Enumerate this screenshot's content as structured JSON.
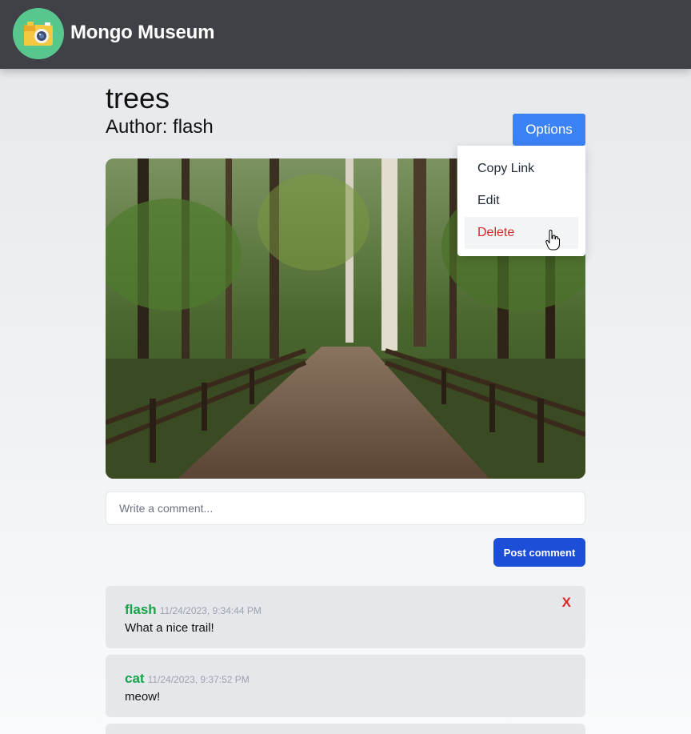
{
  "navbar": {
    "brand": "Mongo Museum",
    "logo_icon": "camera-icon",
    "logo_bg": "#57c78d",
    "bg": "#3f4147"
  },
  "post": {
    "title": "trees",
    "author_line": "Author: flash",
    "image_icon": "forest-trail-photo"
  },
  "options": {
    "button_label": "Options",
    "accent": "#3b82f6",
    "menu": [
      {
        "label": "Copy Link"
      },
      {
        "label": "Edit"
      },
      {
        "label": "Delete",
        "color": "#dc2626"
      }
    ]
  },
  "comment_form": {
    "placeholder": "Write a comment...",
    "submit_label": "Post comment"
  },
  "comments": [
    {
      "author": "flash",
      "timestamp": "11/24/2023, 9:34:44 PM",
      "text": "What a nice trail!",
      "delete_label": "X"
    },
    {
      "author": "cat",
      "timestamp": "11/24/2023, 9:37:52 PM",
      "text": "meow!"
    }
  ]
}
